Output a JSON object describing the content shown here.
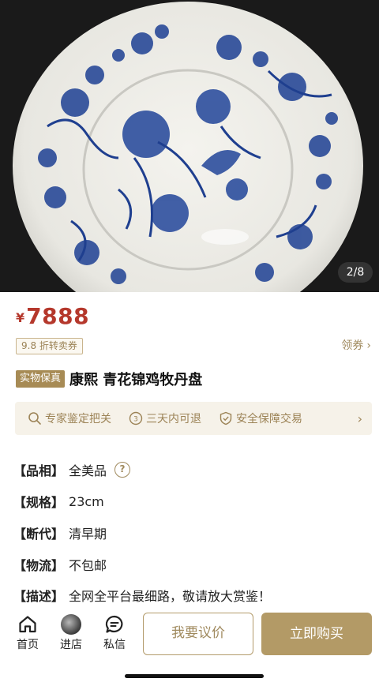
{
  "gallery": {
    "page_indicator": "2/8"
  },
  "price": {
    "symbol": "¥",
    "amount": "7888"
  },
  "coupon": {
    "tag": "9.8 折转卖券",
    "get_label": "领券"
  },
  "product": {
    "badge": "实物保真",
    "title": "康熙 青花锦鸡牧丹盘"
  },
  "guarantees": [
    {
      "icon": "search-icon",
      "label": "专家鉴定把关"
    },
    {
      "icon": "return-icon",
      "label": "三天内可退"
    },
    {
      "icon": "shield-icon",
      "label": "安全保障交易"
    }
  ],
  "specs": [
    {
      "key": "【品相】",
      "value": "全美品"
    },
    {
      "key": "【规格】",
      "value": "23cm"
    },
    {
      "key": "【断代】",
      "value": "清早期"
    },
    {
      "key": "【物流】",
      "value": "不包邮"
    },
    {
      "key": "【描述】",
      "value": "全网全平台最细路，敬请放大赏鉴！"
    }
  ],
  "bottom_nav": [
    {
      "icon": "home-icon",
      "label": "首页"
    },
    {
      "icon": "shop-avatar",
      "label": "进店"
    },
    {
      "icon": "message-icon",
      "label": "私信"
    }
  ],
  "actions": {
    "negotiate": "我要议价",
    "buy": "立即购买"
  },
  "colors": {
    "price": "#b5382c",
    "accent_gold": "#b39a66",
    "guarantee_bg": "#f6f2e9",
    "porcelain_blue": "#1f3f8f"
  }
}
